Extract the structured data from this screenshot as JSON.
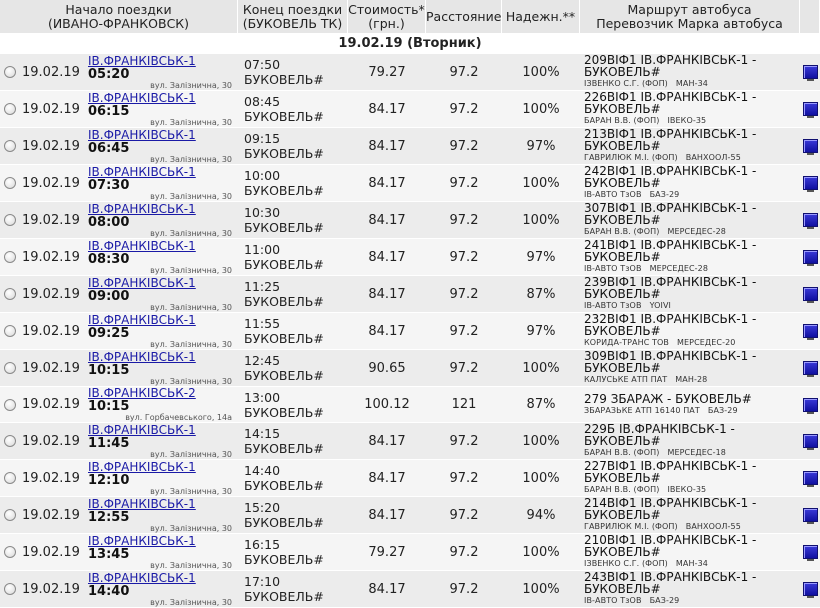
{
  "header": {
    "start_line1": "Начало поездки",
    "start_line2": "(ИВАНО-ФРАНКОВСК)",
    "end_line1": "Конец поездки",
    "end_line2": "(БУКОВЕЛЬ ТК)",
    "cost_line1": "Стоимость*",
    "cost_line2": "(грн.)",
    "distance": "Расстояние",
    "reliability": "Надежн.**",
    "route_line1": "Маршрут автобуса",
    "route_line2": "Перевозчик Марка автобуса"
  },
  "date_heading": "19.02.19 (Вторник)",
  "rows": [
    {
      "date": "19.02.19",
      "station": "ІВ.ФРАНКІВСЬК-1",
      "dep": "05:20",
      "addr": "вул. Залізнична, 30",
      "arr": "07:50 БУКОВЕЛЬ#",
      "cost": "79.27",
      "dist": "97.2",
      "rel": "100%",
      "route": "209ВІФ1 ІВ.ФРАНКІВСЬК-1 - БУКОВЕЛЬ#",
      "carrier": "ІЗВЕНКО С.Г. (ФОП)",
      "bus": "МАН-34"
    },
    {
      "date": "19.02.19",
      "station": "ІВ.ФРАНКІВСЬК-1",
      "dep": "06:15",
      "addr": "вул. Залізнична, 30",
      "arr": "08:45 БУКОВЕЛЬ#",
      "cost": "84.17",
      "dist": "97.2",
      "rel": "100%",
      "route": "226ВІФ1 ІВ.ФРАНКІВСЬК-1 - БУКОВЕЛЬ#",
      "carrier": "БАРАН В.В. (ФОП)",
      "bus": "ІВЕКО-35"
    },
    {
      "date": "19.02.19",
      "station": "ІВ.ФРАНКІВСЬК-1",
      "dep": "06:45",
      "addr": "вул. Залізнична, 30",
      "arr": "09:15 БУКОВЕЛЬ#",
      "cost": "84.17",
      "dist": "97.2",
      "rel": "97%",
      "route": "213ВІФ1 ІВ.ФРАНКІВСЬК-1 - БУКОВЕЛЬ#",
      "carrier": "ГАВРИЛЮК М.І. (ФОП)",
      "bus": "ВАНХООЛ-55"
    },
    {
      "date": "19.02.19",
      "station": "ІВ.ФРАНКІВСЬК-1",
      "dep": "07:30",
      "addr": "вул. Залізнична, 30",
      "arr": "10:00 БУКОВЕЛЬ#",
      "cost": "84.17",
      "dist": "97.2",
      "rel": "100%",
      "route": "242ВІФ1 ІВ.ФРАНКІВСЬК-1 - БУКОВЕЛЬ#",
      "carrier": "ІВ-АВТО ТзОВ",
      "bus": "БАЗ-29"
    },
    {
      "date": "19.02.19",
      "station": "ІВ.ФРАНКІВСЬК-1",
      "dep": "08:00",
      "addr": "вул. Залізнична, 30",
      "arr": "10:30 БУКОВЕЛЬ#",
      "cost": "84.17",
      "dist": "97.2",
      "rel": "100%",
      "route": "307ВІФ1 ІВ.ФРАНКІВСЬК-1 - БУКОВЕЛЬ#",
      "carrier": "БАРАН В.В. (ФОП)",
      "bus": "МЕРСЕДЕС-28"
    },
    {
      "date": "19.02.19",
      "station": "ІВ.ФРАНКІВСЬК-1",
      "dep": "08:30",
      "addr": "вул. Залізнична, 30",
      "arr": "11:00 БУКОВЕЛЬ#",
      "cost": "84.17",
      "dist": "97.2",
      "rel": "97%",
      "route": "241ВІФ1 ІВ.ФРАНКІВСЬК-1 - БУКОВЕЛЬ#",
      "carrier": "ІВ-АВТО ТзОВ",
      "bus": "МЕРСЕДЕС-28"
    },
    {
      "date": "19.02.19",
      "station": "ІВ.ФРАНКІВСЬК-1",
      "dep": "09:00",
      "addr": "вул. Залізнична, 30",
      "arr": "11:25 БУКОВЕЛЬ#",
      "cost": "84.17",
      "dist": "97.2",
      "rel": "87%",
      "route": "239ВІФ1 ІВ.ФРАНКІВСЬК-1 - БУКОВЕЛЬ#",
      "carrier": "ІВ-АВТО ТзОВ",
      "bus": "YOIVI"
    },
    {
      "date": "19.02.19",
      "station": "ІВ.ФРАНКІВСЬК-1",
      "dep": "09:25",
      "addr": "вул. Залізнична, 30",
      "arr": "11:55 БУКОВЕЛЬ#",
      "cost": "84.17",
      "dist": "97.2",
      "rel": "97%",
      "route": "232ВІФ1 ІВ.ФРАНКІВСЬК-1 - БУКОВЕЛЬ#",
      "carrier": "КОРИДА-ТРАНС ТОВ",
      "bus": "МЕРСЕДЕС-20"
    },
    {
      "date": "19.02.19",
      "station": "ІВ.ФРАНКІВСЬК-1",
      "dep": "10:15",
      "addr": "вул. Залізнична, 30",
      "arr": "12:45 БУКОВЕЛЬ#",
      "cost": "90.65",
      "dist": "97.2",
      "rel": "100%",
      "route": "309ВІФ1 ІВ.ФРАНКІВСЬК-1 - БУКОВЕЛЬ#",
      "carrier": "КАЛУСЬКЕ АТП ПАТ",
      "bus": "МАН-28"
    },
    {
      "date": "19.02.19",
      "station": "ІВ.ФРАНКІВСЬК-2",
      "dep": "10:15",
      "addr": "вул. Горбачевського, 14а",
      "arr": "13:00 БУКОВЕЛЬ#",
      "cost": "100.12",
      "dist": "121",
      "rel": "87%",
      "route": "279 ЗБАРАЖ - БУКОВЕЛЬ#",
      "carrier": "ЗБАРАЗЬКЕ АТП 16140 ПАТ",
      "bus": "БАЗ-29"
    },
    {
      "date": "19.02.19",
      "station": "ІВ.ФРАНКІВСЬК-1",
      "dep": "11:45",
      "addr": "вул. Залізнична, 30",
      "arr": "14:15 БУКОВЕЛЬ#",
      "cost": "84.17",
      "dist": "97.2",
      "rel": "100%",
      "route": "229Б ІВ.ФРАНКІВСЬК-1 - БУКОВЕЛЬ#",
      "carrier": "БАРАН В.В. (ФОП)",
      "bus": "МЕРСЕДЕС-18"
    },
    {
      "date": "19.02.19",
      "station": "ІВ.ФРАНКІВСЬК-1",
      "dep": "12:10",
      "addr": "вул. Залізнична, 30",
      "arr": "14:40 БУКОВЕЛЬ#",
      "cost": "84.17",
      "dist": "97.2",
      "rel": "100%",
      "route": "227ВІФ1 ІВ.ФРАНКІВСЬК-1 - БУКОВЕЛЬ#",
      "carrier": "БАРАН В.В. (ФОП)",
      "bus": "ІВЕКО-35"
    },
    {
      "date": "19.02.19",
      "station": "ІВ.ФРАНКІВСЬК-1",
      "dep": "12:55",
      "addr": "вул. Залізнична, 30",
      "arr": "15:20 БУКОВЕЛЬ#",
      "cost": "84.17",
      "dist": "97.2",
      "rel": "94%",
      "route": "214ВІФ1 ІВ.ФРАНКІВСЬК-1 - БУКОВЕЛЬ#",
      "carrier": "ГАВРИЛЮК М.І. (ФОП)",
      "bus": "ВАНХООЛ-55"
    },
    {
      "date": "19.02.19",
      "station": "ІВ.ФРАНКІВСЬК-1",
      "dep": "13:45",
      "addr": "вул. Залізнична, 30",
      "arr": "16:15 БУКОВЕЛЬ#",
      "cost": "79.27",
      "dist": "97.2",
      "rel": "100%",
      "route": "210ВІФ1 ІВ.ФРАНКІВСЬК-1 - БУКОВЕЛЬ#",
      "carrier": "ІЗВЕНКО С.Г. (ФОП)",
      "bus": "МАН-34"
    },
    {
      "date": "19.02.19",
      "station": "ІВ.ФРАНКІВСЬК-1",
      "dep": "14:40",
      "addr": "вул. Залізнична, 30",
      "arr": "17:10 БУКОВЕЛЬ#",
      "cost": "84.17",
      "dist": "97.2",
      "rel": "100%",
      "route": "243ВІФ1 ІВ.ФРАНКІВСЬК-1 - БУКОВЕЛЬ#",
      "carrier": "ІВ-АВТО ТзОВ",
      "bus": "БАЗ-29"
    }
  ]
}
